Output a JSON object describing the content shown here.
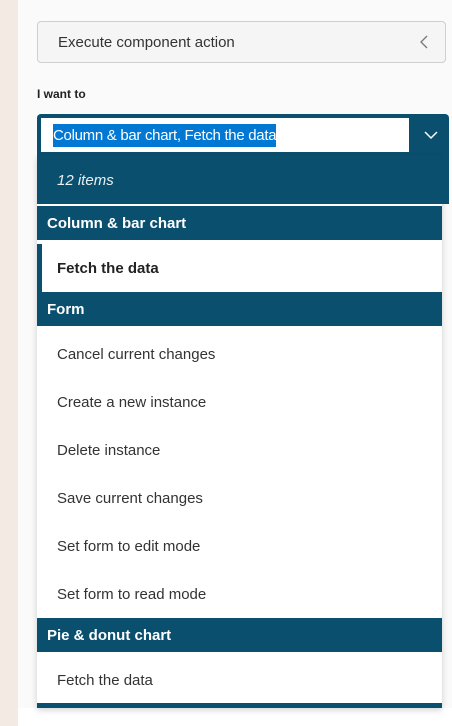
{
  "action_button": {
    "label": "Execute component action"
  },
  "field": {
    "label": "I want to"
  },
  "combo": {
    "value": "Column & bar chart, Fetch the data"
  },
  "list": {
    "count_label": "12 items",
    "groups": [
      {
        "header": "Column & bar chart",
        "items": [
          "Fetch the data"
        ]
      },
      {
        "header": "Form",
        "items": [
          "Cancel current changes",
          "Create a new instance",
          "Delete instance",
          "Save current changes",
          "Set form to edit mode",
          "Set form to read mode"
        ]
      },
      {
        "header": "Pie & donut chart",
        "items": [
          "Fetch the data"
        ]
      }
    ],
    "selected_item": "Column & bar chart, Fetch the data"
  },
  "icons": {
    "action_chevron": "chevron-left-icon",
    "combo_chevron": "chevron-down-icon"
  },
  "colors": {
    "accent": "#0b4f6e",
    "selection": "#0078d4"
  }
}
